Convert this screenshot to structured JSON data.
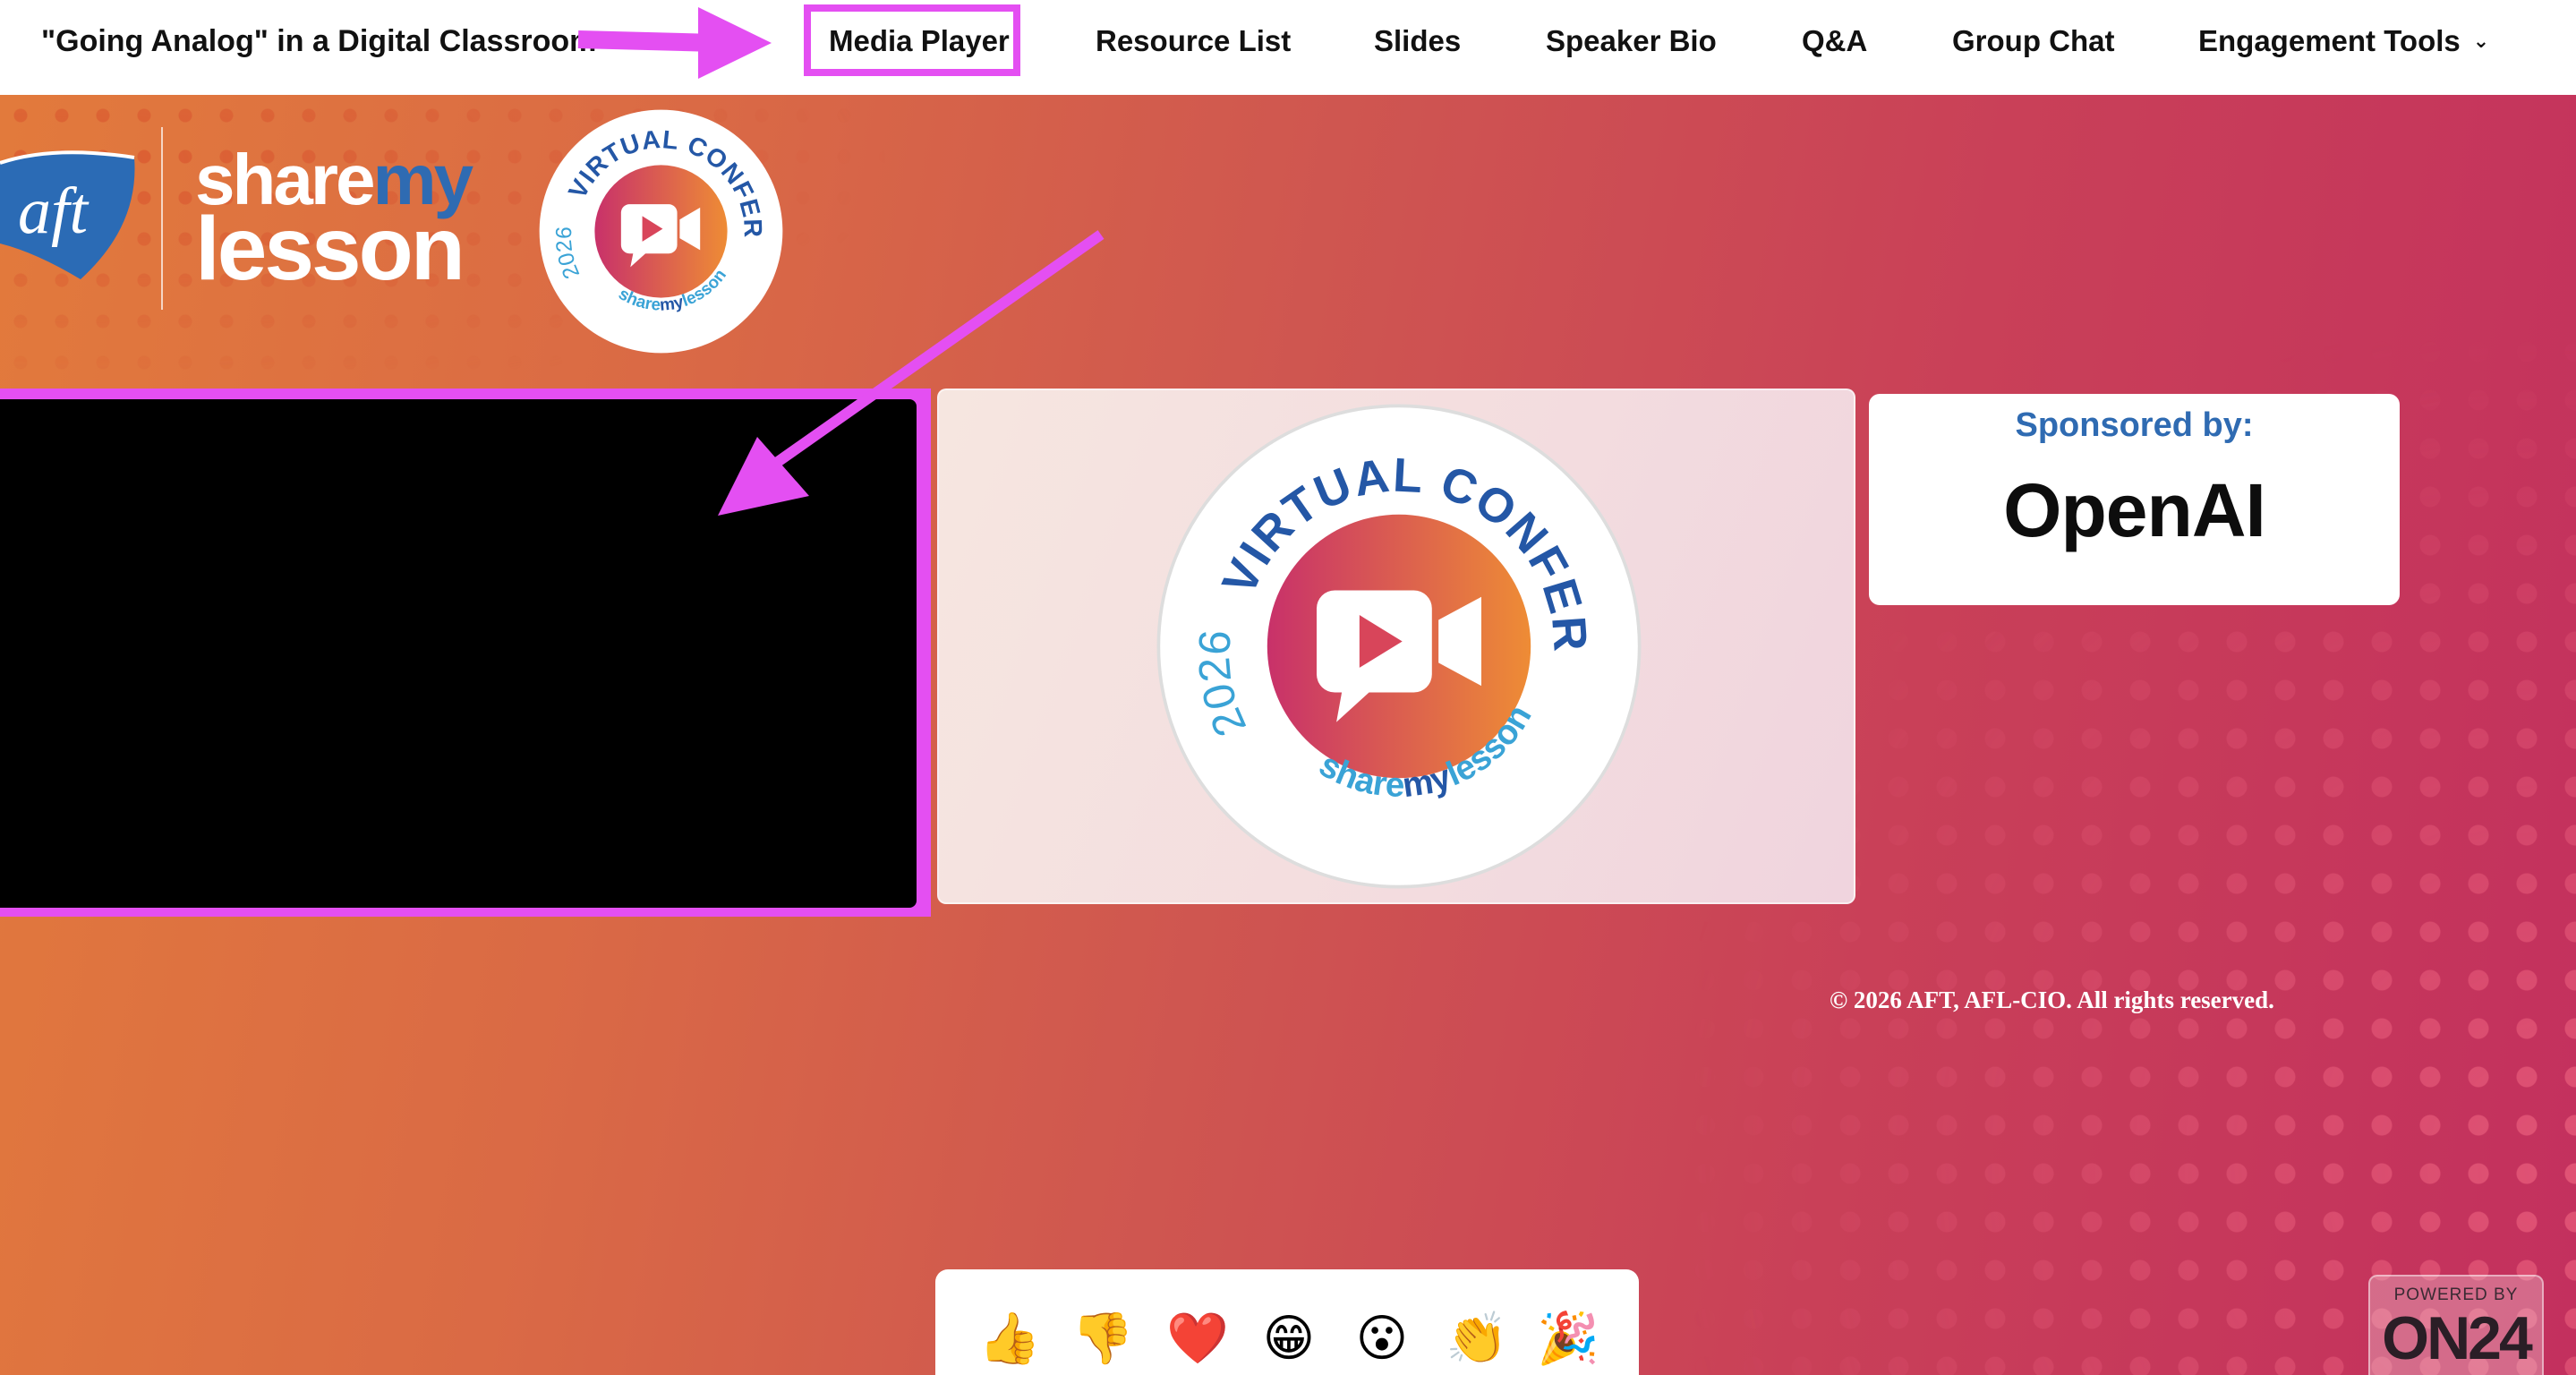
{
  "header": {
    "event_title": "\"Going Analog\" in a Digital Classroom",
    "nav": {
      "media_player": "Media Player",
      "resource_list": "Resource List",
      "slides": "Slides",
      "speaker_bio": "Speaker Bio",
      "qa": "Q&A",
      "group_chat": "Group Chat",
      "engagement_tools": "Engagement Tools"
    },
    "active_item": "Media Player"
  },
  "logos": {
    "aft": "aft",
    "share": "share",
    "my": "my",
    "lesson": "lesson",
    "badge": {
      "year": "2026",
      "arc_text": "VIRTUAL CONFERENCE",
      "brand_share": "share",
      "brand_my": "my",
      "brand_lesson": "lesson"
    }
  },
  "sponsor": {
    "label": "Sponsored by:",
    "name": "OpenAI"
  },
  "footer": {
    "copyright": "© 2026 AFT, AFL-CIO. All rights reserved."
  },
  "reactions": [
    "👍",
    "👎",
    "❤️",
    "😁",
    "😮",
    "👏",
    "🎉"
  ],
  "powered_by": {
    "label": "POWERED BY",
    "brand": "ON24"
  },
  "colors": {
    "highlight": "#e44ff2",
    "brand_blue": "#2f6bb2",
    "badge_orange": "#e8833a",
    "badge_magenta": "#c8316a"
  }
}
